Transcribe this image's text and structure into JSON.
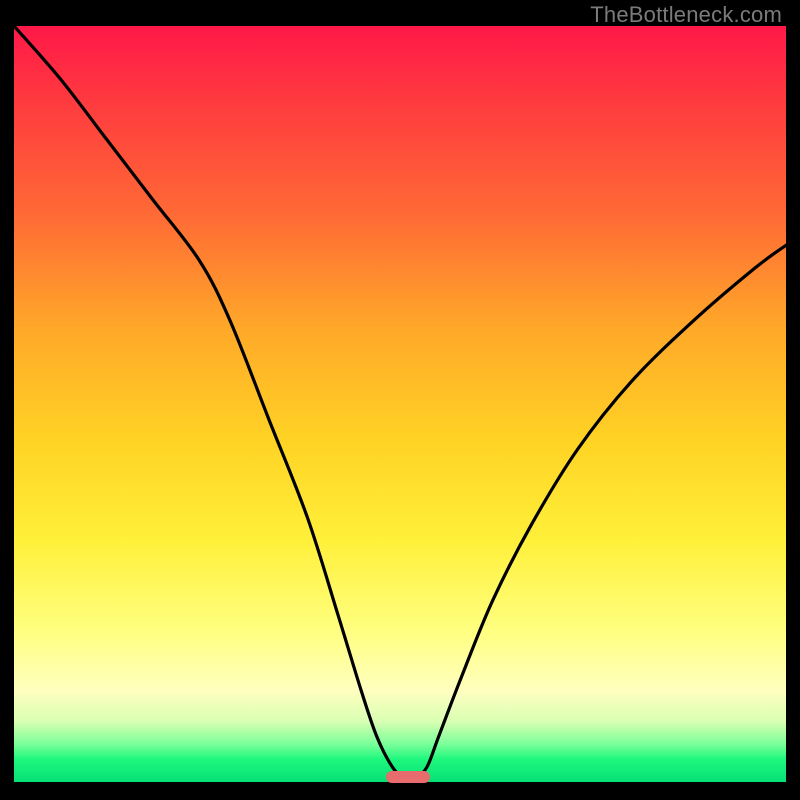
{
  "watermark": "TheBottleneck.com",
  "chart_data": {
    "type": "line",
    "title": "",
    "xlabel": "",
    "ylabel": "",
    "xlim": [
      0,
      100
    ],
    "ylim": [
      0,
      100
    ],
    "grid": false,
    "series": [
      {
        "name": "bottleneck-curve",
        "color": "#000000",
        "x": [
          0,
          6,
          12,
          18,
          24,
          28,
          33,
          38,
          42,
          45,
          47,
          49,
          50.5,
          52,
          53.5,
          55,
          58,
          62,
          67,
          73,
          80,
          88,
          96,
          100
        ],
        "y": [
          100,
          93,
          85,
          77,
          69,
          61,
          48,
          35,
          22,
          12,
          6,
          2,
          0.5,
          0.5,
          2,
          6,
          14,
          24,
          34,
          44,
          53,
          61,
          68,
          71
        ]
      }
    ],
    "marker": {
      "x": 51,
      "y": 0.6,
      "color": "#e86b6e"
    },
    "gradient_stops": [
      {
        "pos": 0,
        "color": "#ff1848"
      },
      {
        "pos": 25,
        "color": "#ff6a35"
      },
      {
        "pos": 55,
        "color": "#ffd324"
      },
      {
        "pos": 80,
        "color": "#ffff80"
      },
      {
        "pos": 95,
        "color": "#7aff9a"
      },
      {
        "pos": 100,
        "color": "#06e176"
      }
    ]
  }
}
